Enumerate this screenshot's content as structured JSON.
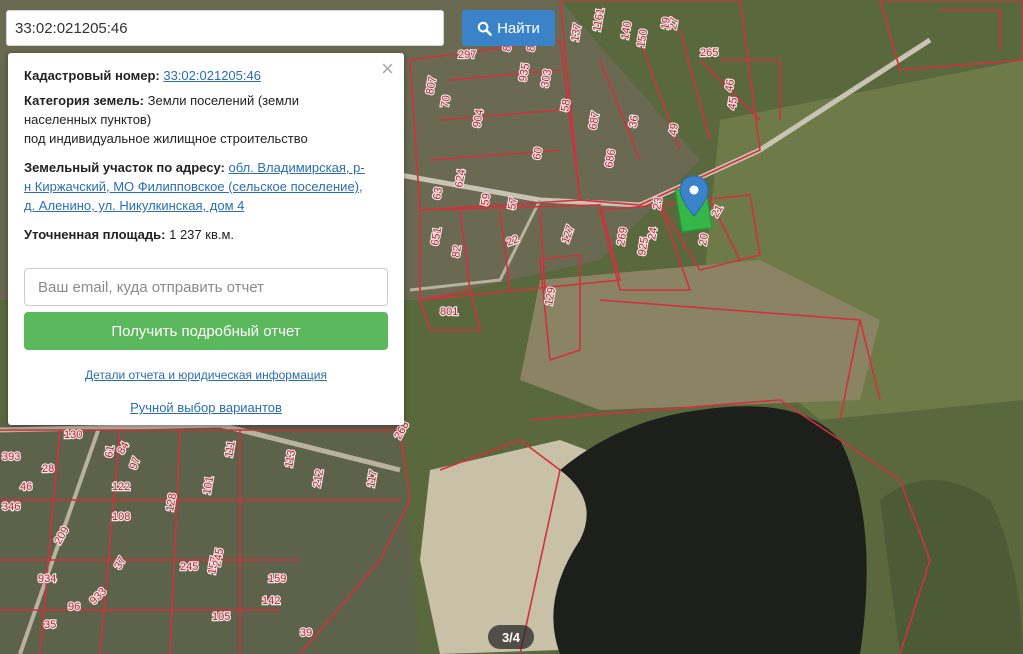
{
  "search": {
    "value": "33:02:021205:46",
    "button_label": "Найти"
  },
  "info": {
    "cadastral_label": "Кадастровый номер:",
    "cadastral_value": "33:02:021205:46",
    "category_label": "Категория земель:",
    "category_value_line1": "Земли поселений (земли",
    "category_value_line2": "населенных пунктов)",
    "category_value_line3": "под индивидуальное жилищное строительство",
    "address_label": "Земельный участок по адресу:",
    "address_value_line1": "обл. Владимирская, р-",
    "address_value_line2": "н Киржачский, МО Филипповское (сельское поселение),",
    "address_value_line3": "д. Аленино, ул. Никулкинская, дом 4",
    "area_label": "Уточненная площадь:",
    "area_value": "1 237 кв.м.",
    "email_placeholder": "Ваш email, куда отправить отчет",
    "report_button": "Получить подробный отчет",
    "details_link": "Детали отчета и юридическая информация",
    "manual_link": "Ручной выбор вариантов",
    "close": "×"
  },
  "pagination": "3/4",
  "parcel_numbers": [
    "297",
    "84",
    "82",
    "807",
    "70",
    "935",
    "303",
    "58",
    "137",
    "1161",
    "140",
    "150",
    "27",
    "19",
    "265",
    "45",
    "687",
    "36",
    "49",
    "46",
    "904",
    "60",
    "686",
    "63",
    "624",
    "59",
    "57",
    "23",
    "21",
    "24",
    "20",
    "22",
    "127",
    "269",
    "925",
    "651",
    "82",
    "129",
    "801",
    "130",
    "61",
    "113",
    "117",
    "122",
    "101",
    "128",
    "212",
    "97",
    "108",
    "393",
    "346",
    "245",
    "157",
    "934",
    "933",
    "159",
    "142",
    "96",
    "245",
    "105",
    "35",
    "39",
    "46",
    "28",
    "37",
    "111",
    "209",
    "268",
    "84"
  ],
  "colors": {
    "parcel_line": "#d1313d",
    "search_button": "#3b83c9",
    "report_button": "#5cb85c",
    "link": "#2a6db5",
    "highlight": "#2fc44a",
    "marker": "#3b83c9"
  }
}
